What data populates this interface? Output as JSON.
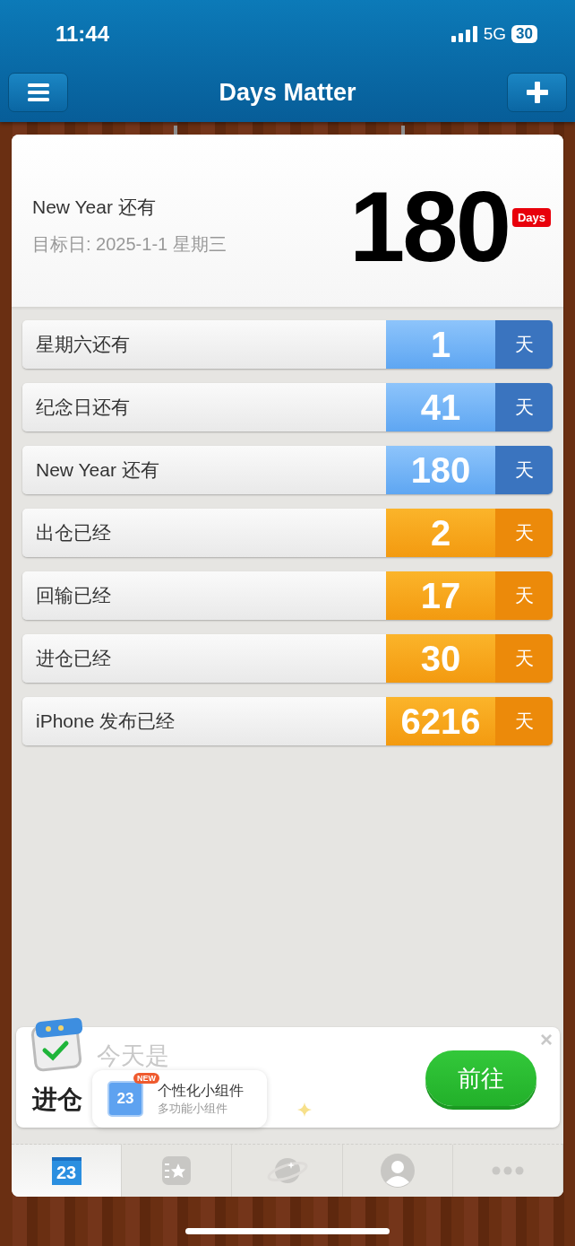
{
  "status_bar": {
    "time": "11:44",
    "network": "5G",
    "battery": "30"
  },
  "nav": {
    "title": "Days Matter"
  },
  "hero": {
    "title": "New Year 还有",
    "subtitle": "目标日: 2025-1-1 星期三",
    "count": "180",
    "unit": "Days"
  },
  "events": [
    {
      "name": "星期六还有",
      "count": "1",
      "unit": "天",
      "kind": "future"
    },
    {
      "name": "纪念日还有",
      "count": "41",
      "unit": "天",
      "kind": "future"
    },
    {
      "name": "New Year 还有",
      "count": "180",
      "unit": "天",
      "kind": "future"
    },
    {
      "name": "出仓已经",
      "count": "2",
      "unit": "天",
      "kind": "past"
    },
    {
      "name": "回输已经",
      "count": "17",
      "unit": "天",
      "kind": "past"
    },
    {
      "name": "进仓已经",
      "count": "30",
      "unit": "天",
      "kind": "past"
    },
    {
      "name": "iPhone 发布已经",
      "count": "6216",
      "unit": "天",
      "kind": "past"
    }
  ],
  "banner": {
    "heading": "今天是",
    "text": "进仓",
    "button": "前往",
    "close": "×",
    "tooltip": {
      "badge": "NEW",
      "icon_number": "23",
      "title": "个性化小组件",
      "subtitle": "多功能小组件"
    }
  },
  "tabs": [
    {
      "kind": "calendar",
      "label": "23",
      "selected": true
    },
    {
      "kind": "notebook",
      "selected": false
    },
    {
      "kind": "planet",
      "selected": false
    },
    {
      "kind": "profile",
      "selected": false
    },
    {
      "kind": "more",
      "selected": false
    }
  ]
}
